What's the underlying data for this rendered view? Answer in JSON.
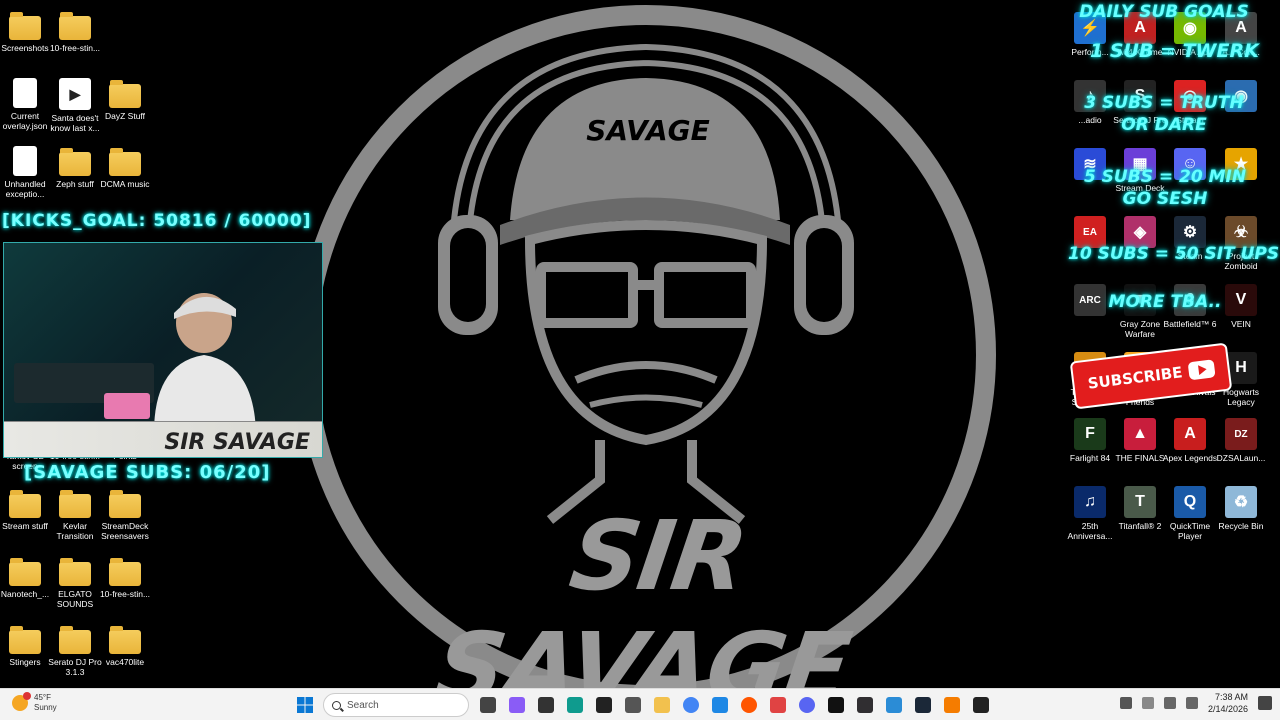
{
  "overlays": {
    "kicks_goal": "[KICKS_GOAL:   50816 / 60000]",
    "subs_count": "[SAVAGE SUBS: 06/20]",
    "cam_banner": "SIR SAVAGE",
    "wallpaper_title": "SIR SAVAGE",
    "cap_text": "SAVAGE"
  },
  "goals": {
    "title": "DAILY SUB GOALS",
    "g1": "1 SUB = TWERK",
    "g2": "3 SUBS = TRUTH OR DARE",
    "g3": "5 SUBS = 20 MIN GO SESH",
    "g4": "10 SUBS = 50 SIT UPS",
    "g5": "MORE TBA..",
    "subscribe": "SUBSCRIBE"
  },
  "left_icons": [
    {
      "label": "Screenshots",
      "type": "folder"
    },
    {
      "label": "10-free-stin...",
      "type": "folder"
    },
    {
      "label": "Current overlay.json",
      "type": "file"
    },
    {
      "label": "Santa does't know last x...",
      "type": "media"
    },
    {
      "label": "DayZ Stuff",
      "type": "folder"
    },
    {
      "label": "Unhandled exceptio...",
      "type": "file"
    },
    {
      "label": "Zeph stuff",
      "type": "folder"
    },
    {
      "label": "DCMA music",
      "type": "folder"
    },
    {
      "label": "Tarkov SD screen",
      "type": "folder"
    },
    {
      "label": "10-free-stin...",
      "type": "folder"
    },
    {
      "label": "Points",
      "type": "folder"
    },
    {
      "label": "Stream stuff",
      "type": "folder"
    },
    {
      "label": "Kevlar Transition",
      "type": "folder"
    },
    {
      "label": "StreamDeck Sreensavers",
      "type": "folder"
    },
    {
      "label": "Nanotech_...",
      "type": "folder"
    },
    {
      "label": "ELGATO SOUNDS",
      "type": "folder"
    },
    {
      "label": "10-free-stin...",
      "type": "folder"
    },
    {
      "label": "Stingers",
      "type": "folder"
    },
    {
      "label": "Serato DJ Pro 3.1.3",
      "type": "folder"
    },
    {
      "label": "vac470lite",
      "type": "folder"
    }
  ],
  "right_icons": [
    {
      "label": "Perform...",
      "color": "#1f6fd0",
      "glyph": "⚡"
    },
    {
      "label": "A64 Xtreme",
      "color": "#c02020",
      "glyph": "A"
    },
    {
      "label": "NVIDIA App",
      "color": "#76b900",
      "glyph": "◉"
    },
    {
      "label": "A... Con...",
      "color": "#444",
      "glyph": "A"
    },
    {
      "label": "...adio",
      "color": "#333",
      "glyph": "♪"
    },
    {
      "label": "Serato DJ Pro",
      "color": "#222",
      "glyph": "S"
    },
    {
      "label": "Stream",
      "color": "#d22",
      "glyph": "◎"
    },
    {
      "label": "",
      "color": "#2b6cb0",
      "glyph": "◉"
    },
    {
      "label": "",
      "color": "#2a4bd7",
      "glyph": "≋"
    },
    {
      "label": "Stream Deck",
      "color": "#6b3fd8",
      "glyph": "▦"
    },
    {
      "label": "",
      "color": "#5865f2",
      "glyph": "☺"
    },
    {
      "label": "",
      "color": "#e6a400",
      "glyph": "★"
    },
    {
      "label": "",
      "color": "#d02020",
      "glyph": "EA"
    },
    {
      "label": "",
      "color": "#b0306a",
      "glyph": "◈"
    },
    {
      "label": "Steam",
      "color": "#1b2838",
      "glyph": "⚙"
    },
    {
      "label": "Project Zomboid",
      "color": "#6b4a2a",
      "glyph": "☣"
    },
    {
      "label": "",
      "color": "#333",
      "glyph": "ARC"
    },
    {
      "label": "Gray Zone Warfare",
      "color": "#111",
      "glyph": "▼"
    },
    {
      "label": "Battlefield™ 6",
      "color": "#3a3a3a",
      "glyph": "6"
    },
    {
      "label": "VEIN",
      "color": "#2a0a0a",
      "glyph": "V"
    },
    {
      "label": "TCG Card Shop Si...",
      "color": "#d68c12",
      "glyph": "♠"
    },
    {
      "label": "Golf With Your Friends",
      "color": "#f5a623",
      "glyph": "G"
    },
    {
      "label": "Marvel Rivals",
      "color": "#1e2a5a",
      "glyph": "R"
    },
    {
      "label": "Hogwarts Legacy",
      "color": "#1a1a1a",
      "glyph": "H"
    },
    {
      "label": "Farlight 84",
      "color": "#1a3a1a",
      "glyph": "F"
    },
    {
      "label": "THE FINALS",
      "color": "#c81e3c",
      "glyph": "▲"
    },
    {
      "label": "Apex Legends",
      "color": "#c81e1e",
      "glyph": "A"
    },
    {
      "label": "DZSALaun...",
      "color": "#7a1c1c",
      "glyph": "DZ"
    },
    {
      "label": "25th Anniversa...",
      "color": "#0a2a6a",
      "glyph": "♫"
    },
    {
      "label": "Titanfall® 2",
      "color": "#4a5a4a",
      "glyph": "T"
    },
    {
      "label": "QuickTime Player",
      "color": "#1a5aa8",
      "glyph": "Q"
    },
    {
      "label": "Recycle Bin",
      "color": "#8fb8d8",
      "glyph": "♻"
    }
  ],
  "taskbar": {
    "temperature": "45°F",
    "condition": "Sunny",
    "search_placeholder": "Search",
    "time": "7:38 AM",
    "date": "2/14/2026",
    "apps": [
      "start",
      "search",
      "task-view",
      "copilot",
      "terminal",
      "app-1",
      "app-2",
      "app-3",
      "file-explorer",
      "chrome",
      "photos",
      "soundcloud",
      "maps",
      "discord",
      "capcut",
      "obs",
      "notepad",
      "steam",
      "app-4",
      "app-5"
    ]
  }
}
